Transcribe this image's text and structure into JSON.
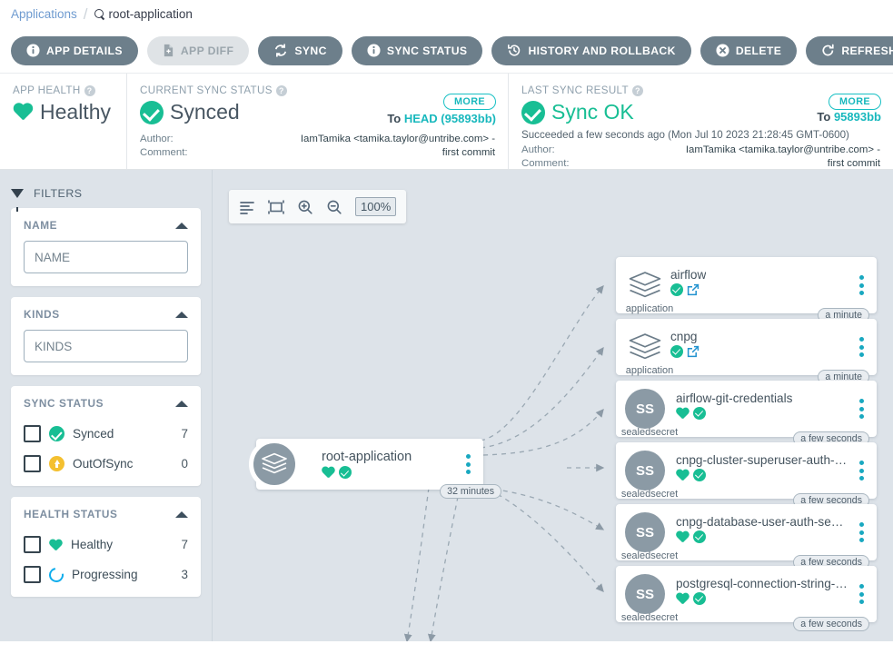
{
  "breadcrumb": {
    "root": "Applications",
    "separator": "/",
    "current": "root-application"
  },
  "toolbar": {
    "buttons": [
      {
        "label": "APP DETAILS",
        "icon": "info-icon",
        "disabled": false
      },
      {
        "label": "APP DIFF",
        "icon": "file-diff-icon",
        "disabled": true
      },
      {
        "label": "SYNC",
        "icon": "sync-icon",
        "disabled": false
      },
      {
        "label": "SYNC STATUS",
        "icon": "info-icon",
        "disabled": false
      },
      {
        "label": "HISTORY AND ROLLBACK",
        "icon": "history-icon",
        "disabled": false
      },
      {
        "label": "DELETE",
        "icon": "delete-circle-icon",
        "disabled": false
      },
      {
        "label": "REFRESH",
        "icon": "refresh-icon",
        "disabled": false,
        "caret": true
      }
    ]
  },
  "status": {
    "app_health": {
      "title": "APP HEALTH",
      "value": "Healthy",
      "icon": "heart-icon",
      "color": "#18be94"
    },
    "current_sync": {
      "title": "CURRENT SYNC STATUS",
      "value": "Synced",
      "icon": "check-circle-icon",
      "more_label": "MORE",
      "target_prefix": "To",
      "target_revision": "HEAD (95893bb)",
      "author_label": "Author:",
      "comment_label": "Comment:",
      "author_value": "IamTamika <tamika.taylor@untribe.com> -",
      "comment_value": "first commit"
    },
    "last_sync": {
      "title": "LAST SYNC RESULT",
      "value": "Sync OK",
      "icon": "check-circle-icon",
      "more_label": "MORE",
      "target_prefix": "To",
      "target_revision": "95893bb",
      "succeeded": "Succeeded a few seconds ago (Mon Jul 10 2023 21:28:45 GMT-0600)",
      "author_label": "Author:",
      "comment_label": "Comment:",
      "author_value": "IamTamika <tamika.taylor@untribe.com> -",
      "comment_value": "first commit"
    }
  },
  "filters": {
    "heading": "FILTERS",
    "icon": "funnel-icon",
    "name": {
      "title": "NAME",
      "placeholder": "NAME",
      "value": ""
    },
    "kinds": {
      "title": "KINDS",
      "placeholder": "KINDS",
      "value": ""
    },
    "sync_status": {
      "title": "SYNC STATUS",
      "rows": [
        {
          "label": "Synced",
          "count": "7",
          "icon": "check-circle-icon",
          "checked": false
        },
        {
          "label": "OutOfSync",
          "count": "0",
          "icon": "arrow-up-circle-icon",
          "checked": false
        }
      ]
    },
    "health_status": {
      "title": "HEALTH STATUS",
      "rows": [
        {
          "label": "Healthy",
          "count": "7",
          "icon": "heart-icon",
          "checked": false
        },
        {
          "label": "Progressing",
          "count": "3",
          "icon": "progressing-icon",
          "checked": false
        }
      ]
    }
  },
  "graph": {
    "toolbar": {
      "tidy_icon": "align-left-icon",
      "fit_icon": "fit-to-screen-icon",
      "zoom_in_icon": "zoom-in-icon",
      "zoom_out_icon": "zoom-out-icon",
      "zoom_level": "100%"
    },
    "root": {
      "name": "root-application",
      "kind": "",
      "icon": "layers-icon",
      "age": "32 minutes",
      "badges": [
        "heart-icon",
        "check-circle-icon"
      ]
    },
    "children": [
      {
        "name": "airflow",
        "kind": "application",
        "icon": "layers-icon",
        "age": "a minute",
        "badges": [
          "check-circle-icon",
          "external-link-icon"
        ]
      },
      {
        "name": "cnpg",
        "kind": "application",
        "icon": "layers-icon",
        "age": "a minute",
        "badges": [
          "check-circle-icon",
          "external-link-icon"
        ]
      },
      {
        "name": "airflow-git-credentials",
        "kind": "sealedsecret",
        "icon": "SS",
        "age": "a few seconds",
        "badges": [
          "heart-icon",
          "check-circle-icon"
        ]
      },
      {
        "name": "cnpg-cluster-superuser-auth-…",
        "kind": "sealedsecret",
        "icon": "SS",
        "age": "a few seconds",
        "badges": [
          "heart-icon",
          "check-circle-icon"
        ]
      },
      {
        "name": "cnpg-database-user-auth-sec…",
        "kind": "sealedsecret",
        "icon": "SS",
        "age": "a few seconds",
        "badges": [
          "heart-icon",
          "check-circle-icon"
        ]
      },
      {
        "name": "postgresql-connection-string-…",
        "kind": "sealedsecret",
        "icon": "SS",
        "age": "a few seconds",
        "badges": [
          "heart-icon",
          "check-circle-icon"
        ]
      }
    ]
  }
}
